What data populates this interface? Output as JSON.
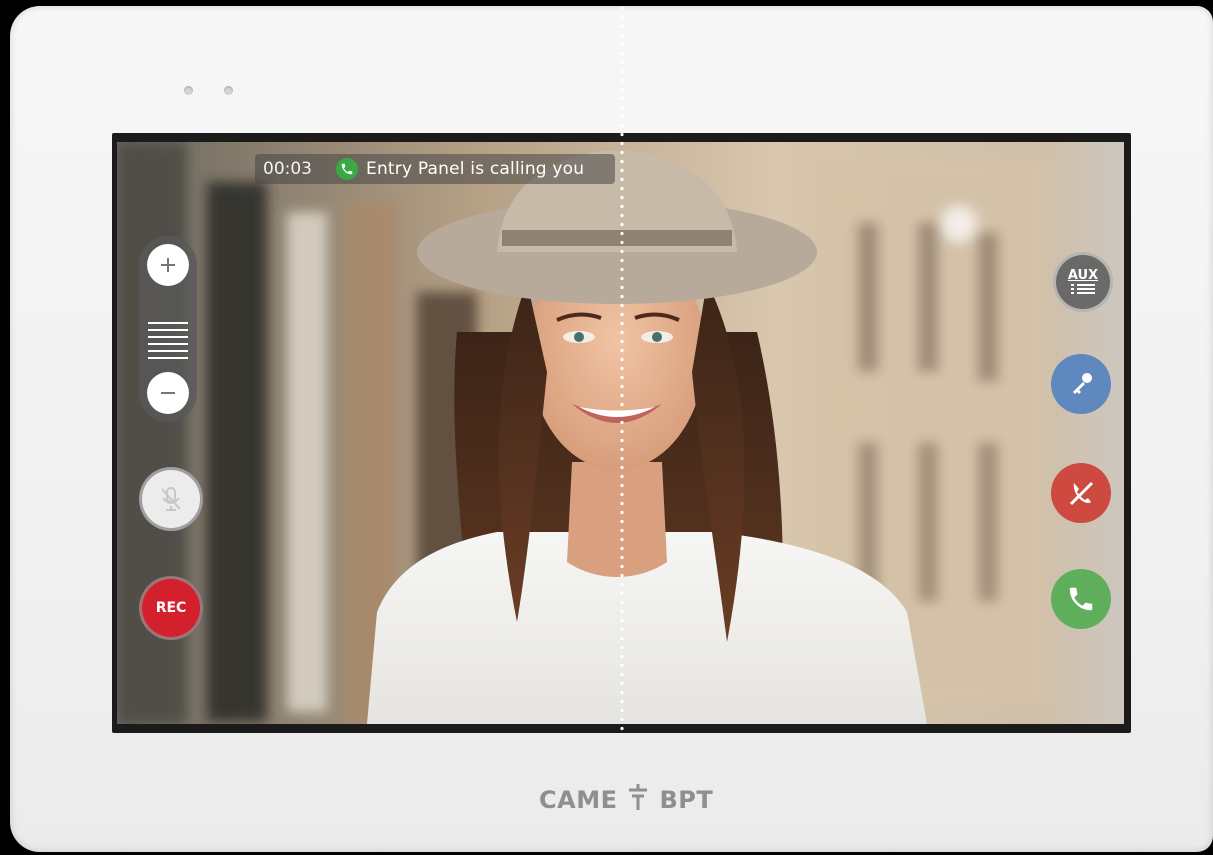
{
  "device": {
    "brand_left": "CAME",
    "brand_right": "BPT"
  },
  "call_status": {
    "timer": "00:03",
    "message": "Entry Panel is calling you",
    "icon": "phone-icon"
  },
  "volume": {
    "increase_icon": "plus-icon",
    "decrease_icon": "minus-icon"
  },
  "controls_left": {
    "mute_icon": "microphone-muted-icon",
    "rec_label": "REC"
  },
  "controls_right": {
    "aux_label": "AUX",
    "door_icon": "key-icon",
    "reject_icon": "hang-up-icon",
    "answer_icon": "phone-answer-icon"
  },
  "colors": {
    "answer_green": "#5fae5c",
    "reject_red": "#ce4a40",
    "key_blue": "#5f88be",
    "rec_red": "#d4202d",
    "status_green": "#39a845"
  }
}
